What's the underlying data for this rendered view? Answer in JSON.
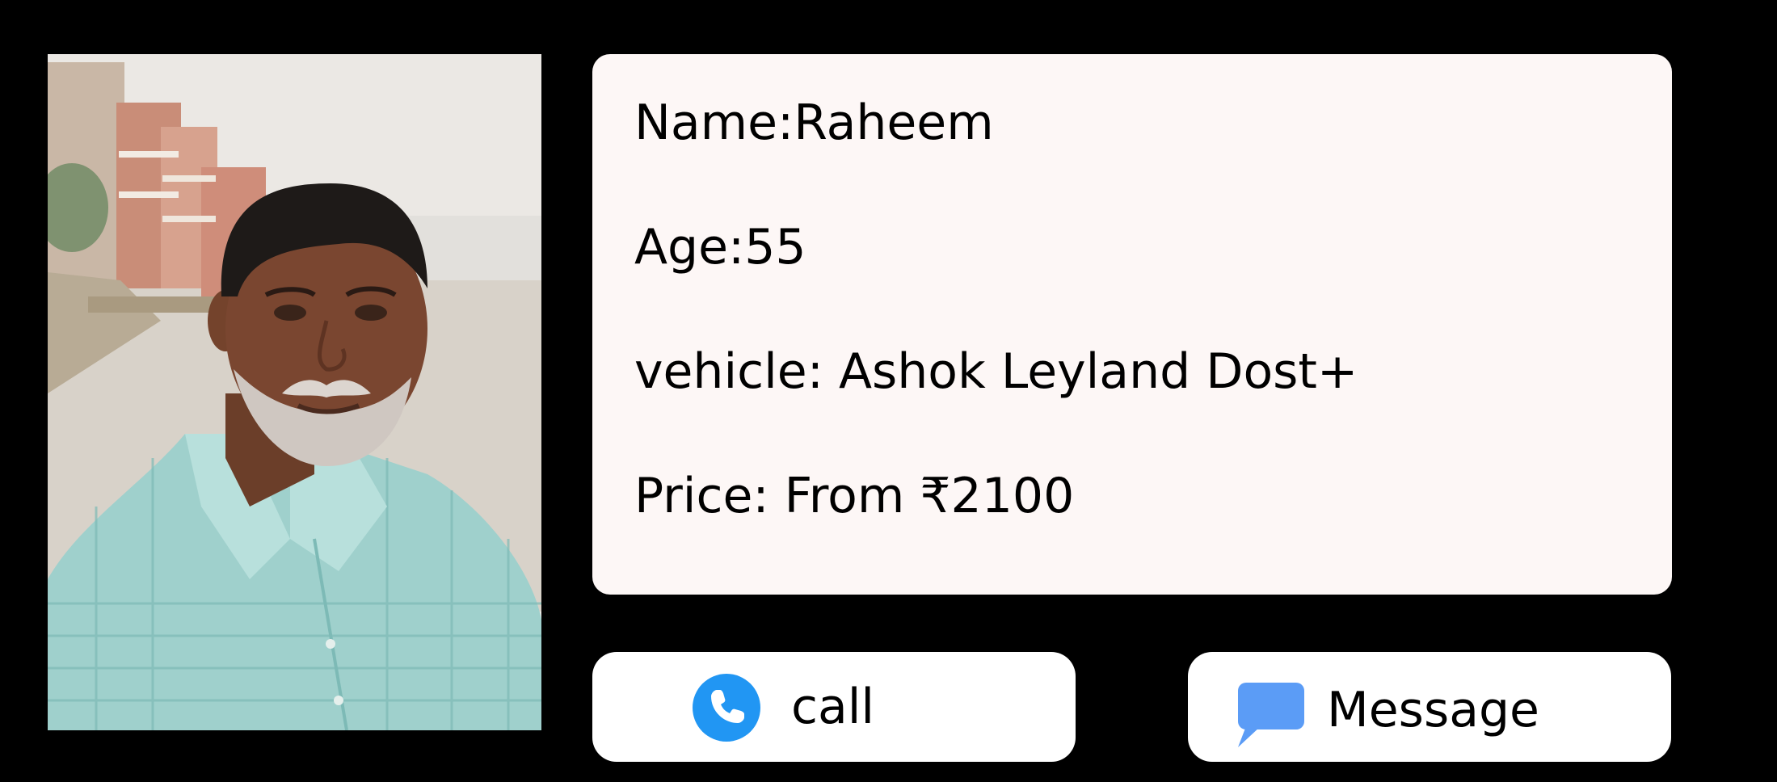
{
  "profile": {
    "name_line": "Name:Raheem",
    "age_line": "Age:55",
    "vehicle_line": "vehicle: Ashok Leyland Dost+",
    "price_line": "Price: From ₹2100"
  },
  "actions": {
    "call_label": "call",
    "message_label": "Message"
  },
  "icons": {
    "call": "phone-icon",
    "message": "chat-bubble-icon"
  },
  "colors": {
    "background": "#000000",
    "card": "#fdf7f6",
    "button": "#ffffff",
    "phone_icon": "#2196f3",
    "message_icon": "#5b9cf6"
  }
}
